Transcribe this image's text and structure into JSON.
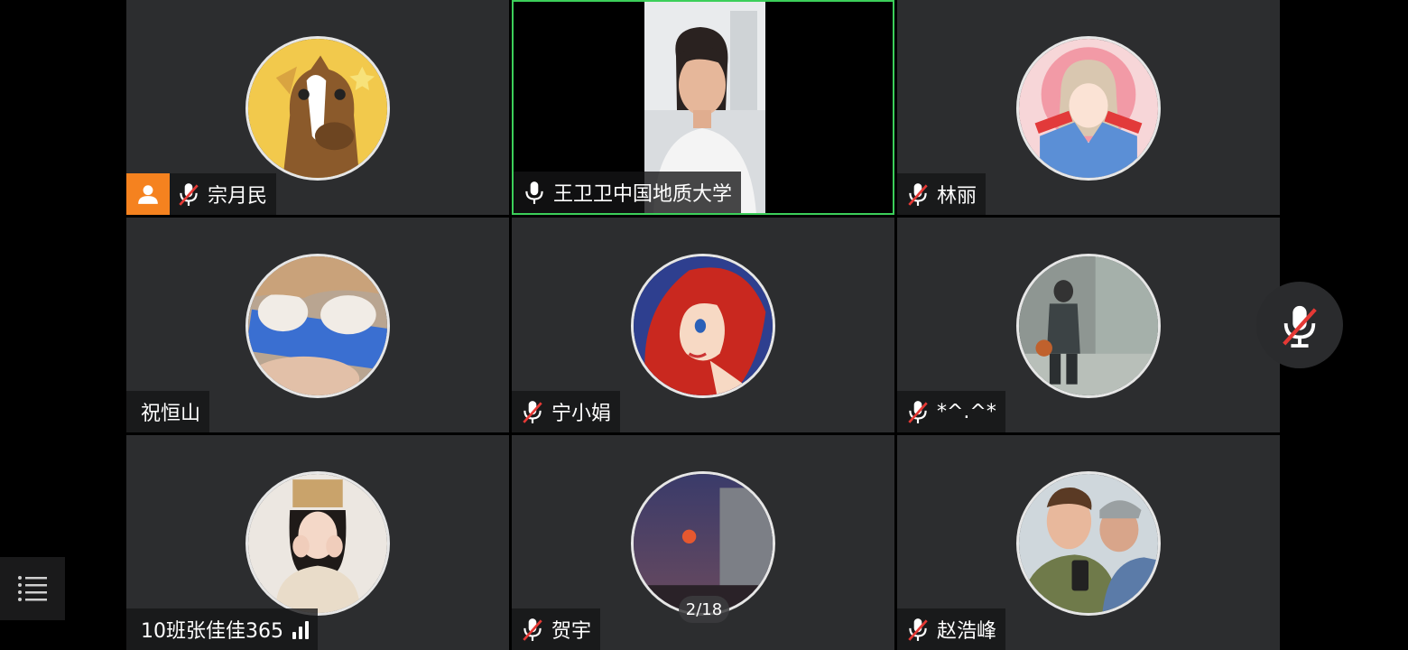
{
  "participants": [
    {
      "name": "宗月民",
      "muted": true,
      "host": true,
      "avatar": "cartoon-horse-avatar"
    },
    {
      "name": "王卫卫中国地质大学",
      "muted": false,
      "host": false,
      "active_speaker": true,
      "video": "live-video-woman"
    },
    {
      "name": "林丽",
      "muted": true,
      "avatar": "anime-girl-avatar"
    },
    {
      "name": "祝恒山",
      "muted": null,
      "avatar": "cat-paws-avatar"
    },
    {
      "name": "宁小娟",
      "muted": true,
      "avatar": "mermaid-avatar"
    },
    {
      "name": "*^.^*",
      "muted": true,
      "avatar": "winter-figure-avatar"
    },
    {
      "name": "10班张佳佳365",
      "muted": null,
      "signal": "signal-bars-icon",
      "avatar": "girl-with-hat-avatar"
    },
    {
      "name": "贺宇",
      "muted": true,
      "avatar": "sunset-moon-avatar"
    },
    {
      "name": "赵浩峰",
      "muted": true,
      "avatar": "two-men-avatar"
    }
  ],
  "page_indicator": "2/18",
  "controls": {
    "floating_mic": "mic-muted-icon",
    "menu": "menu-list-icon"
  },
  "colors": {
    "tile_bg": "#2c2d2f",
    "active_border": "#3ccf5a",
    "host_badge": "#f5821f",
    "mute_slash": "#e53935"
  }
}
